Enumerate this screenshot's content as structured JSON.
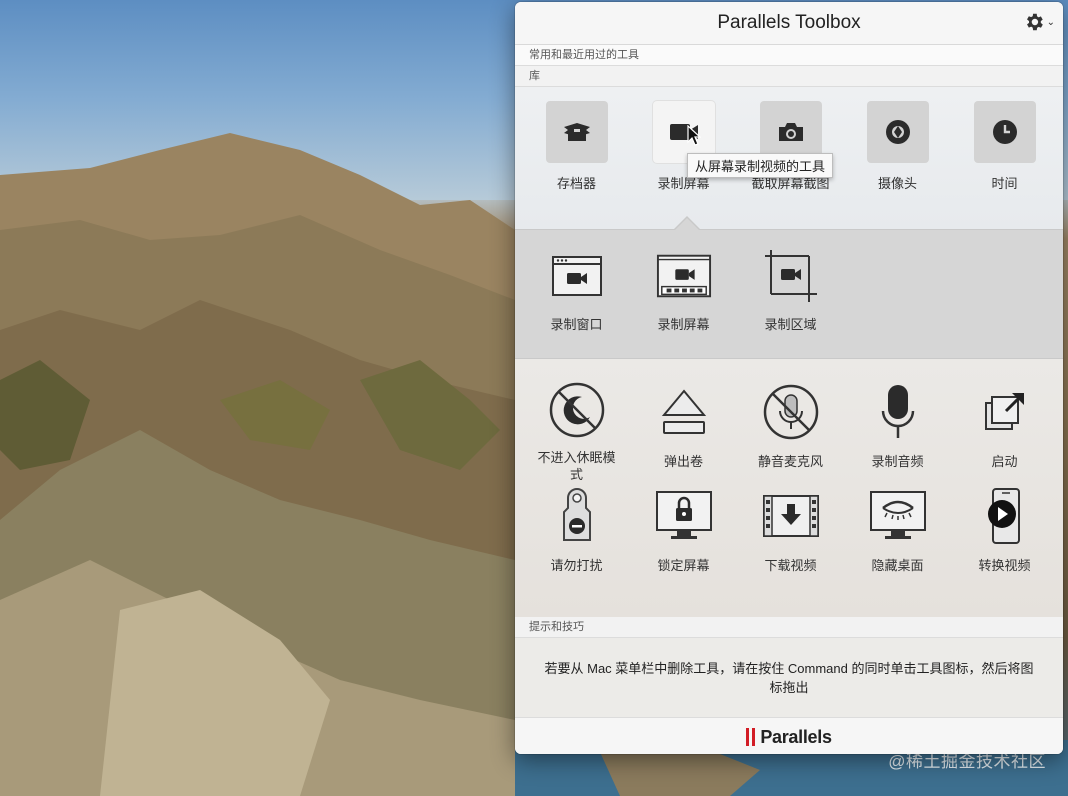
{
  "window": {
    "title": "Parallels Toolbox",
    "settings_icon": "gear-icon",
    "settings_chevron": "⌄"
  },
  "sections": {
    "recent": "常用和最近用过的工具",
    "library": "库",
    "tips": "提示和技巧"
  },
  "library_tools": [
    {
      "label": "存档器",
      "icon": "archive-icon"
    },
    {
      "label": "录制屏幕",
      "icon": "video-camera-icon",
      "active": true
    },
    {
      "label": "截取屏幕截图",
      "icon": "camera-icon"
    },
    {
      "label": "摄像头",
      "icon": "webcam-icon"
    },
    {
      "label": "时间",
      "icon": "clock-icon"
    }
  ],
  "tooltip": "从屏幕录制视频的工具",
  "record_subtools": [
    {
      "label": "录制窗口",
      "icon": "record-window-icon"
    },
    {
      "label": "录制屏幕",
      "icon": "record-screen-icon"
    },
    {
      "label": "录制区域",
      "icon": "record-area-icon"
    }
  ],
  "more_tools_row1": [
    {
      "label": "不进入休眠模式",
      "icon": "no-sleep-icon"
    },
    {
      "label": "弹出卷",
      "icon": "eject-icon"
    },
    {
      "label": "静音麦克风",
      "icon": "mute-microphone-icon"
    },
    {
      "label": "录制音频",
      "icon": "microphone-icon"
    },
    {
      "label": "启动",
      "icon": "launch-icon"
    }
  ],
  "more_tools_row2": [
    {
      "label": "请勿打扰",
      "icon": "do-not-disturb-icon"
    },
    {
      "label": "锁定屏幕",
      "icon": "lock-screen-icon"
    },
    {
      "label": "下载视频",
      "icon": "download-video-icon"
    },
    {
      "label": "隐藏桌面",
      "icon": "hide-desktop-icon"
    },
    {
      "label": "转换视频",
      "icon": "convert-video-icon"
    }
  ],
  "tip_text": "若要从 Mac 菜单栏中删除工具，请在按住 Command 的同时单击工具图标，然后将图标拖出",
  "footer": {
    "brand": "Parallels"
  },
  "watermark": "@稀土掘金技术社区",
  "colors": {
    "brand_red": "#d21c25",
    "icon_dark": "#2b2b2b"
  }
}
